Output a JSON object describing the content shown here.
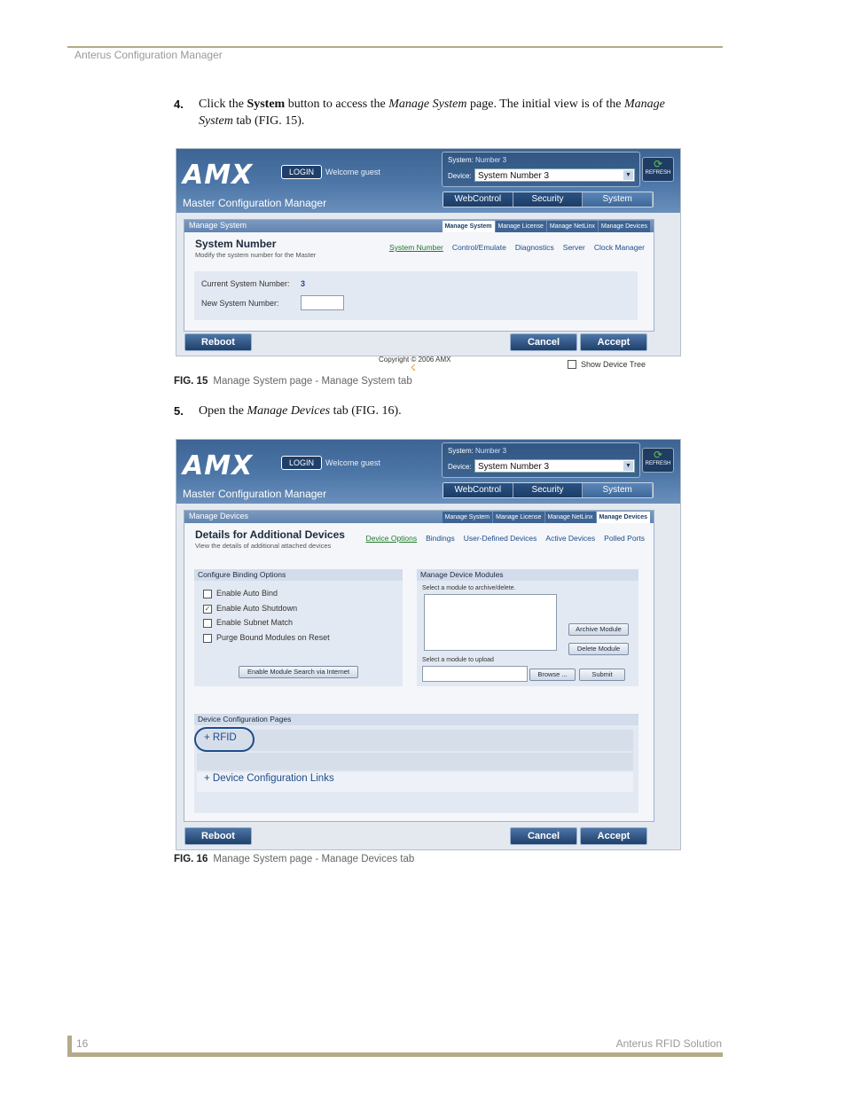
{
  "header": {
    "title": "Anterus Configuration Manager"
  },
  "footer": {
    "page_number": "16",
    "product": "Anterus RFID Solution"
  },
  "step4": {
    "number": "4.",
    "text_html": "Click the <b>System</b> button to access the <i>Manage System</i> page. The initial view is of the <i>Manage System</i> tab (FIG. 15)."
  },
  "step5": {
    "number": "5.",
    "text_html": "Open the <i>Manage Devices</i> tab (FIG. 16)."
  },
  "fig15": {
    "label": "FIG. 15",
    "caption": "Manage System page - Manage System tab"
  },
  "fig16": {
    "label": "FIG. 16",
    "caption": "Manage System page - Manage Devices tab"
  },
  "app": {
    "logo": "AMX",
    "login": "LOGIN",
    "welcome": "Welcome guest",
    "title": "Master Configuration Manager",
    "system_label": "System:",
    "system_value": "Number 3",
    "device_label": "Device:",
    "device_value": "System Number 3",
    "refresh": "REFRESH",
    "nav": [
      "WebControl",
      "Security",
      "System"
    ],
    "panel_tabs": [
      "Manage System",
      "Manage License",
      "Manage NetLinx",
      "Manage Devices"
    ],
    "reboot": "Reboot",
    "cancel": "Cancel",
    "accept": "Accept",
    "copyright": "Copyright © 2006 AMX",
    "show_device_tree": "Show Device Tree"
  },
  "screen1": {
    "panel_title": "Manage System",
    "section_title": "System Number",
    "section_sub": "Modify the system number for the Master",
    "links": [
      "System Number",
      "Control/Emulate",
      "Diagnostics",
      "Server",
      "Clock Manager"
    ],
    "current_label": "Current System Number:",
    "current_value": "3",
    "new_label": "New System Number:"
  },
  "screen2": {
    "panel_title": "Manage Devices",
    "section_title": "Details for Additional Devices",
    "section_sub": "View the details of additional attached devices",
    "links": [
      "Device Options",
      "Bindings",
      "User-Defined Devices",
      "Active Devices",
      "Polled Ports"
    ],
    "binding_title": "Configure Binding Options",
    "options": [
      {
        "label": "Enable Auto Bind",
        "checked": false
      },
      {
        "label": "Enable Auto Shutdown",
        "checked": true
      },
      {
        "label": "Enable Subnet Match",
        "checked": false
      },
      {
        "label": "Purge Bound Modules on Reset",
        "checked": false
      }
    ],
    "enable_search": "Enable Module Search via Internet",
    "modules_title": "Manage Device Modules",
    "select_archive": "Select a module to archive/delete.",
    "archive": "Archive Module",
    "delete": "Delete Module",
    "select_upload": "Select a module to upload",
    "browse": "Browse ...",
    "submit": "Submit",
    "config_pages_title": "Device Configuration Pages",
    "rfid": "+ RFID",
    "config_links": "+ Device Configuration Links"
  }
}
